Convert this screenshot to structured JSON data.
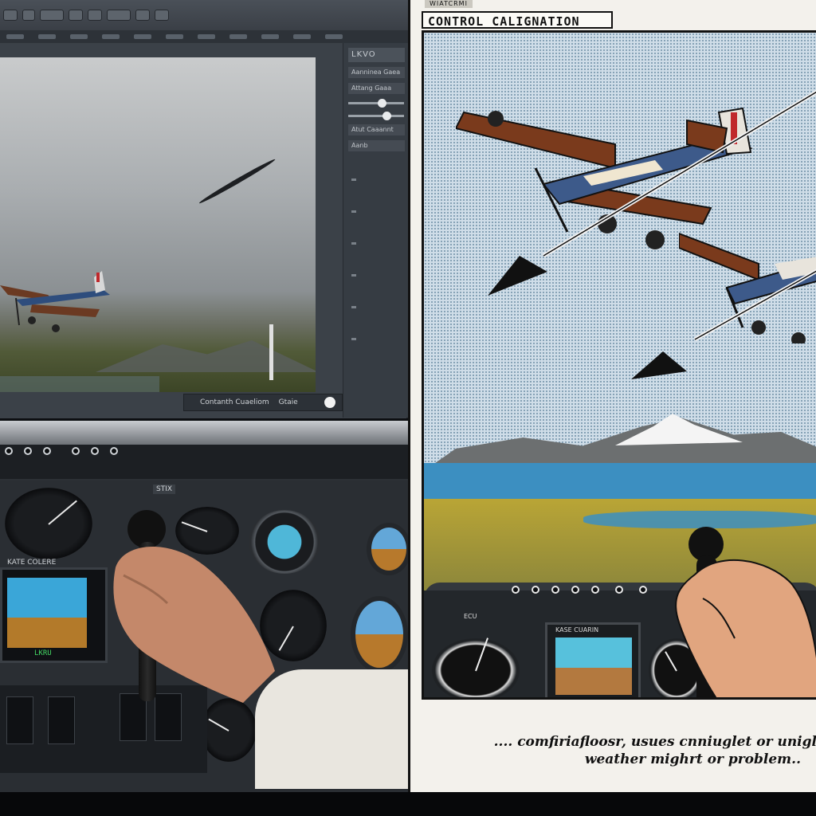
{
  "simulator": {
    "side_panel": {
      "header": "LKVO",
      "rows": [
        "Aanninea Gaea",
        "Attang Gaaa",
        "Atut Caaannt",
        "Aanb"
      ]
    },
    "sliders": [
      {
        "name": "slider-1",
        "level": 0.62
      },
      {
        "name": "slider-2",
        "level": 0.72
      }
    ],
    "status": {
      "left": "Contanth Cuaeliom",
      "right": "Gtaie"
    },
    "cockpit": {
      "panel_label": "STIX",
      "pfd_label": "KATE COLERE",
      "pfd_readout": "LKRU"
    }
  },
  "comic": {
    "tag": "WIATCRMI",
    "title": "CONTROL  CALIGNATION",
    "caption_line1": ".... comfiriafloosr, usues cnniuglet or unigl",
    "caption_line2": "weather mighrt or problem..",
    "pfd_label": "KASE CUARIN",
    "dash_label": "ECU"
  },
  "colors": {
    "sky_comic": "#cfdde8",
    "lake": "#3c8fc1",
    "plane_wing": "#7a3a1c",
    "plane_body": "#3d5a8a",
    "attitude_sky": "#3aa6d8",
    "attitude_ground": "#b37a2a"
  }
}
